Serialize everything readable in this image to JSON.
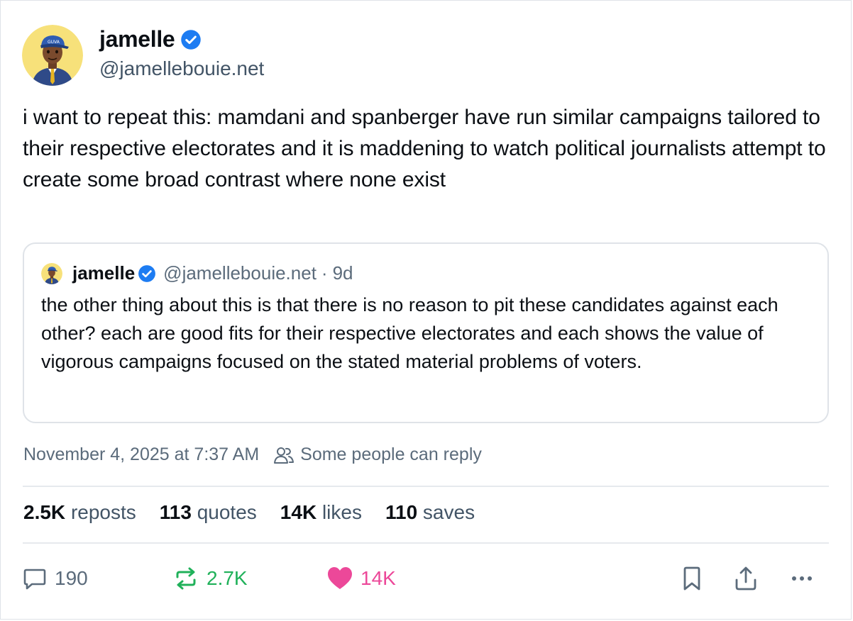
{
  "author": {
    "name": "jamelle",
    "handle": "@jamellebouie.net",
    "verified": true
  },
  "post": {
    "text": "i want to repeat this: mamdani and spanberger have run similar campaigns tailored to their respective electorates and it is maddening to watch political journalists attempt to create some broad contrast where none exist",
    "timestamp": "November 4, 2025 at 7:37 AM",
    "reply_setting": "Some people can reply"
  },
  "quoted_post": {
    "name": "jamelle",
    "handle": "@jamellebouie.net",
    "separator": "·",
    "age": "9d",
    "text": "the other thing about this is that there is no reason to pit these candidates against each other? each are good fits for their respective electorates and each shows the value of vigorous campaigns focused on the stated material problems of voters."
  },
  "stats": {
    "reposts": {
      "count": "2.5K",
      "label": "reposts"
    },
    "quotes": {
      "count": "113",
      "label": "quotes"
    },
    "likes": {
      "count": "14K",
      "label": "likes"
    },
    "saves": {
      "count": "110",
      "label": "saves"
    }
  },
  "actions": {
    "reply_count": "190",
    "repost_count": "2.7K",
    "like_count": "14K"
  },
  "colors": {
    "verified_blue": "#1d7cf2",
    "repost_green": "#20b15a",
    "like_pink": "#ec4899",
    "muted_text": "#5b6b7b",
    "avatar_bg": "#f7e17a"
  }
}
